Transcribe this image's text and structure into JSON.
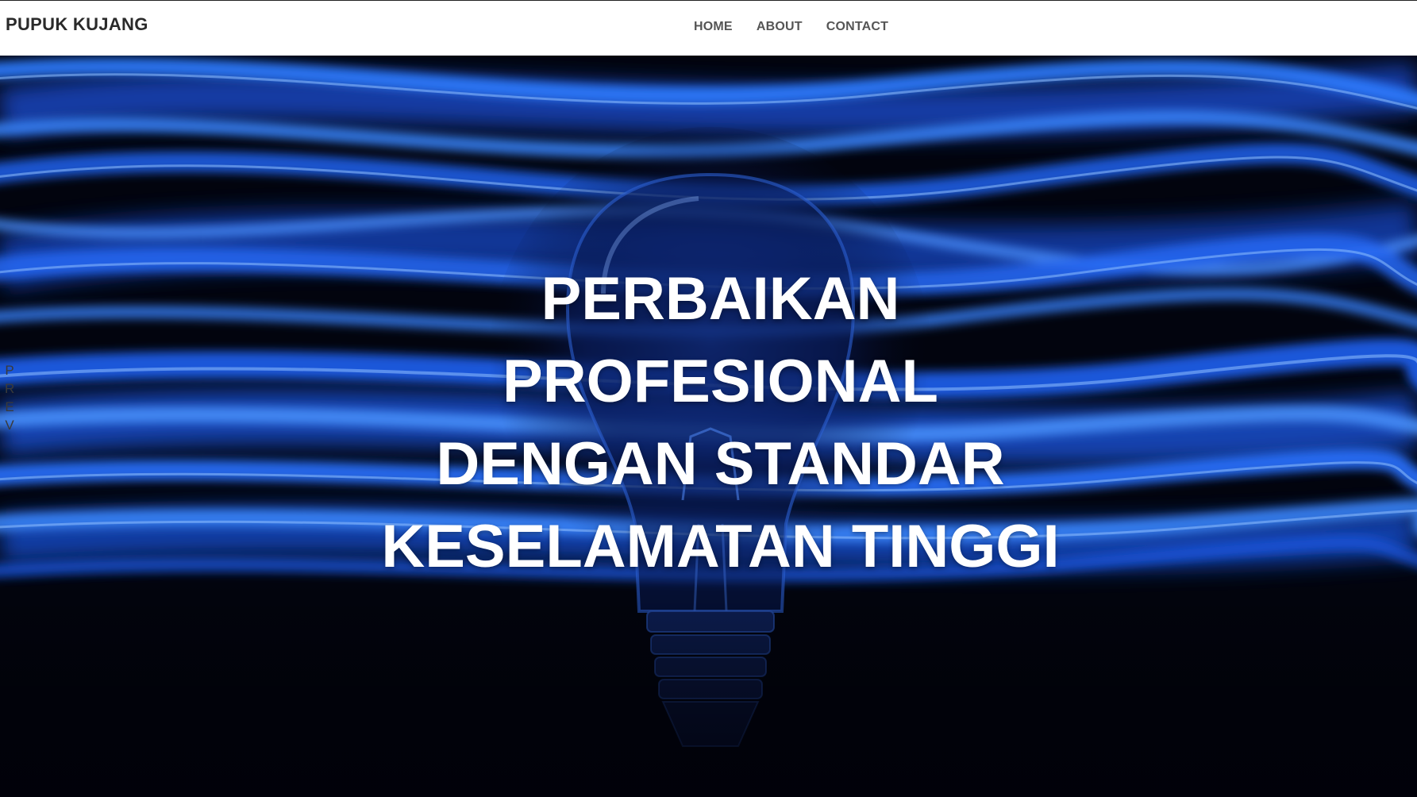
{
  "brand": {
    "name": "PUPUK KUJANG"
  },
  "nav": {
    "items": [
      {
        "label": "HOME"
      },
      {
        "label": "ABOUT"
      },
      {
        "label": "CONTACT"
      }
    ]
  },
  "hero": {
    "title_lines": [
      "PERBAIKAN",
      "PROFESIONAL",
      "DENGAN STANDAR",
      "KESELAMATAN TINGGI"
    ],
    "background_image": "light-bulb-with-blue-light-streaks",
    "prev_letters": [
      "P",
      "R",
      "E",
      "V"
    ]
  },
  "colors": {
    "nav_background": "#ffffff",
    "brand_text": "#2a2a2a",
    "nav_text": "#555555",
    "hero_text": "#ffffff",
    "hero_accent": "#1e6cff",
    "hero_dark": "#02040e"
  }
}
